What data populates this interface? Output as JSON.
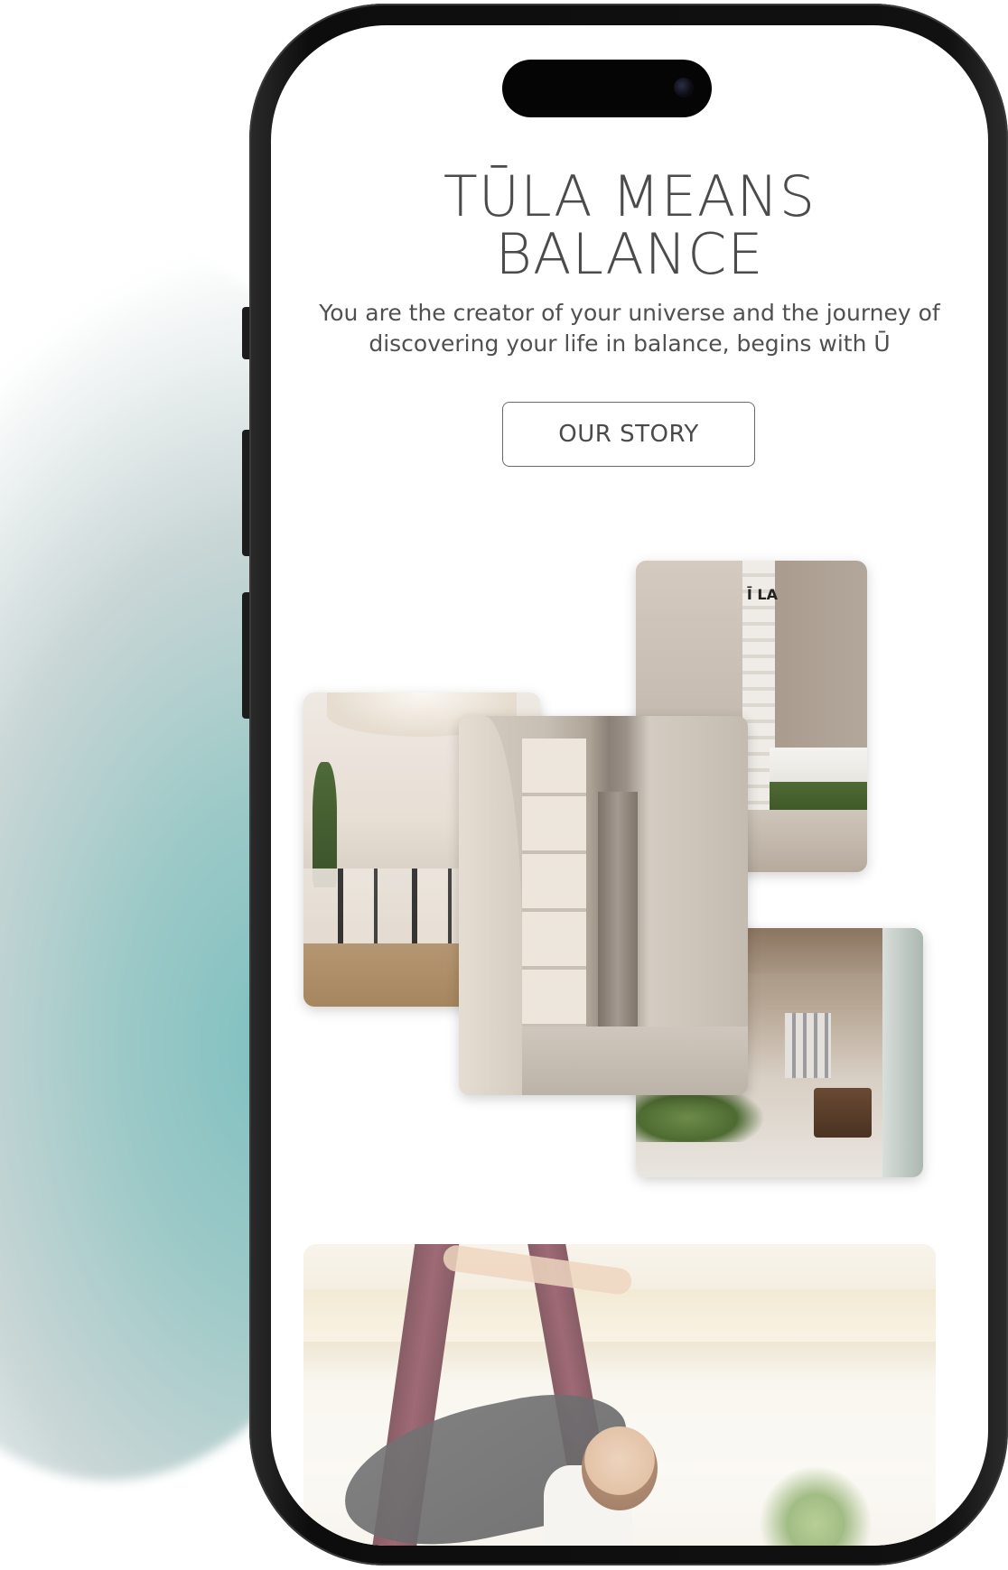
{
  "hero": {
    "headline_line1": "TŪLA MEANS",
    "headline_line2": "BALANCE",
    "subtitle_line1": "You are the creator of your universe and the journey of",
    "subtitle_line2": "discovering your life in balance, begins with Ū",
    "cta_label": "OUR STORY"
  },
  "gallery": {
    "images": [
      {
        "name": "studio-lounge-photo"
      },
      {
        "name": "reformer-studio-photo"
      },
      {
        "name": "hallway-photo"
      },
      {
        "name": "retail-corner-photo"
      }
    ],
    "lounge_logo_text": "Ī LA"
  },
  "feature": {
    "image": "aerial-yoga-photo"
  },
  "colors": {
    "accent_teal": "#7fc0c0",
    "text_gray": "#4b4b4b",
    "phone_frame": "#111111"
  }
}
